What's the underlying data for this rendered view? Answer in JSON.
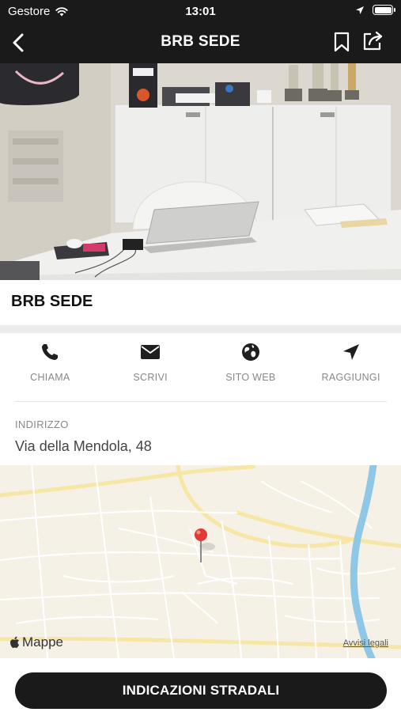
{
  "status_bar": {
    "carrier": "Gestore",
    "time": "13:01"
  },
  "nav": {
    "title": "BRB SEDE"
  },
  "place": {
    "title": "BRB SEDE"
  },
  "actions": [
    {
      "label": "CHIAMA",
      "icon": "phone-icon"
    },
    {
      "label": "SCRIVI",
      "icon": "mail-icon"
    },
    {
      "label": "SITO WEB",
      "icon": "globe-icon"
    },
    {
      "label": "RAGGIUNGI",
      "icon": "navigation-arrow-icon"
    }
  ],
  "address": {
    "label": "INDIRIZZO",
    "value": "Via della Mendola, 48"
  },
  "map": {
    "brand": "Mappe",
    "legal": "Avvisi legali",
    "pin_color": "#e53935"
  },
  "cta": {
    "label": "INDICAZIONI STRADALI"
  },
  "colors": {
    "bar": "#1a1a1a",
    "river": "#8ec8e6",
    "map_bg": "#f5f1e6"
  }
}
